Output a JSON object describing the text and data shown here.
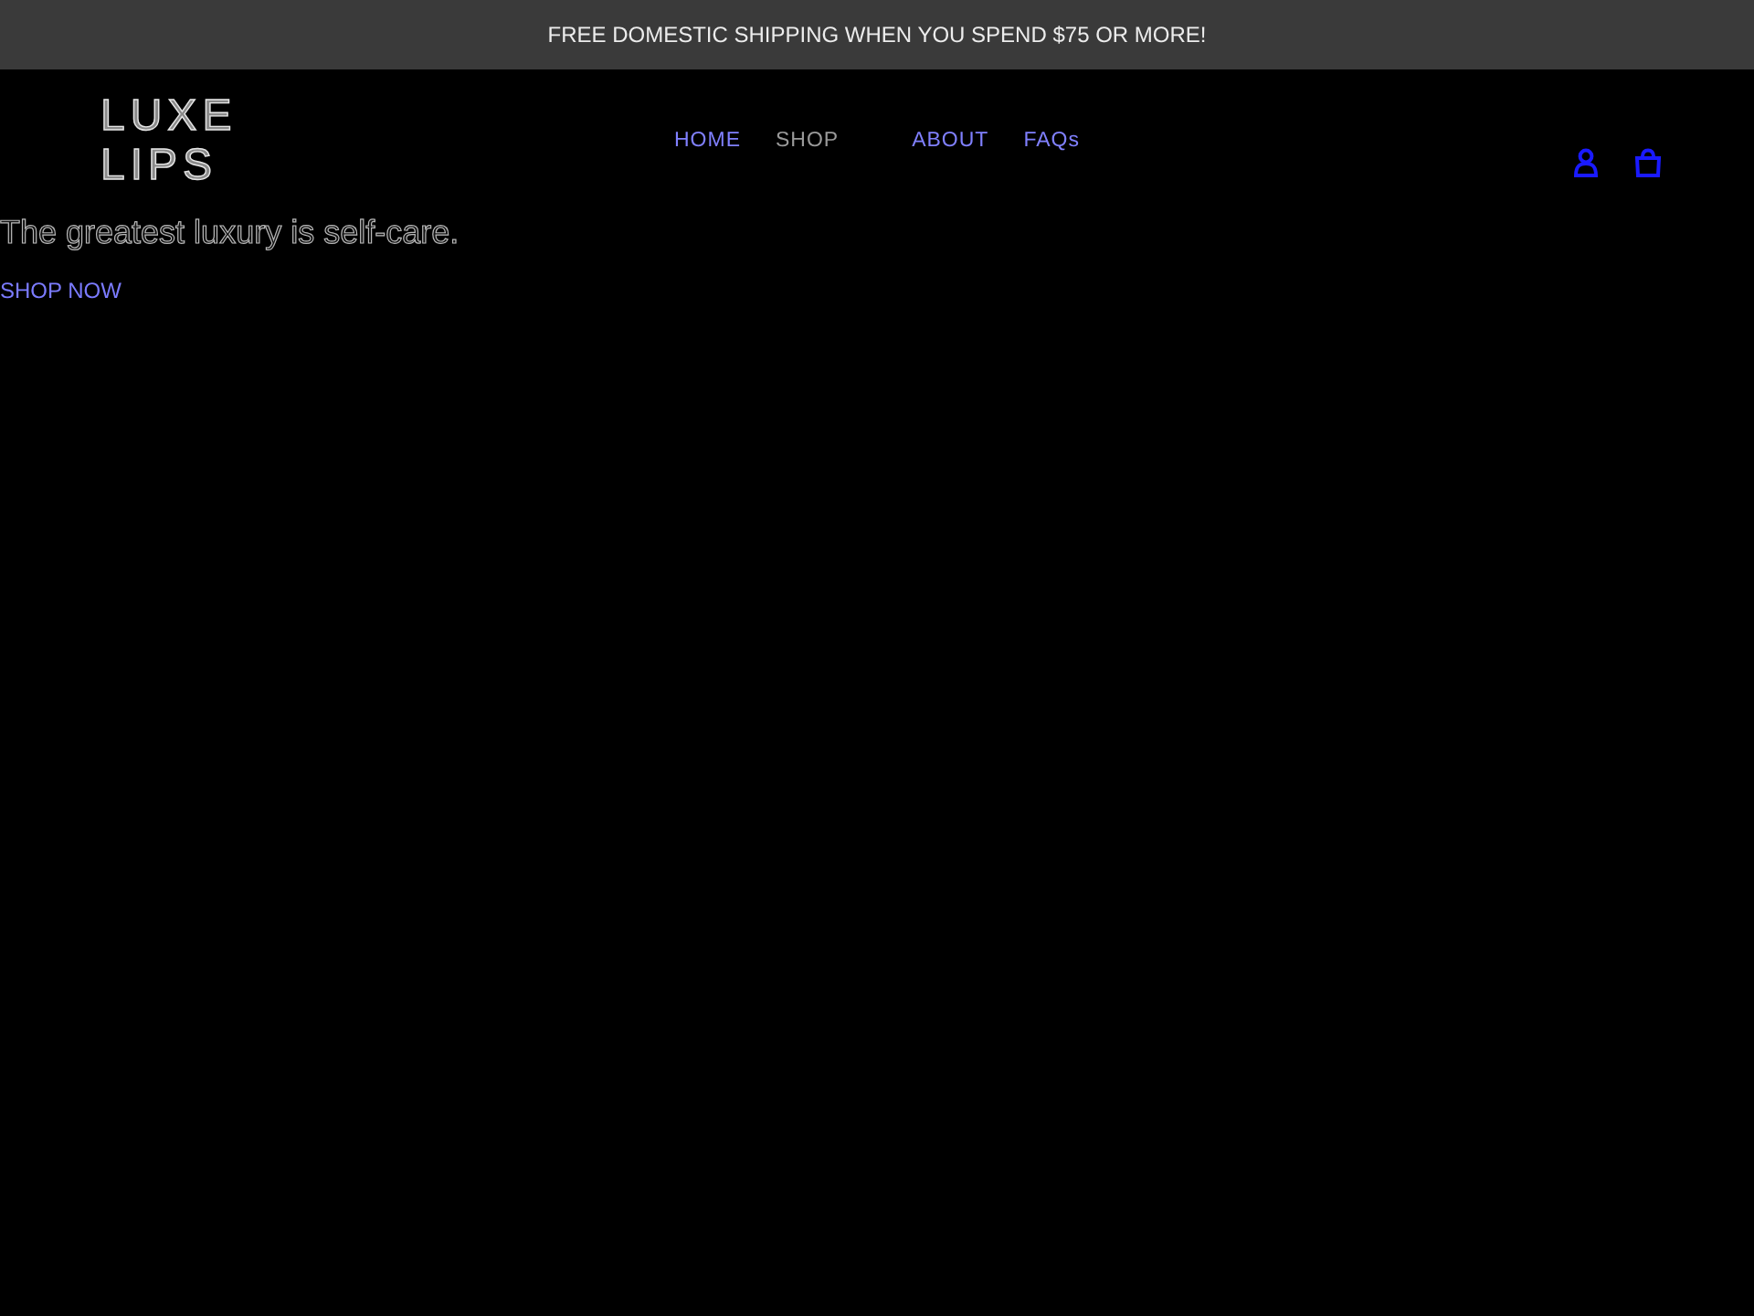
{
  "announcement": {
    "text": "FREE DOMESTIC SHIPPING WHEN YOU SPEND $75 OR MORE!"
  },
  "header": {
    "logo": {
      "lines": [
        "LUXE",
        "LIPS"
      ]
    },
    "nav": [
      {
        "label": "HOME",
        "kind": "link"
      },
      {
        "label": "SHOP",
        "kind": "dropdown"
      },
      {
        "label": "ABOUT",
        "kind": "link"
      },
      {
        "label": "FAQs",
        "kind": "link"
      }
    ],
    "icons": [
      {
        "kind": "account"
      },
      {
        "kind": "cart"
      }
    ]
  },
  "hero": {
    "heading": "The greatest luxury is self-care.",
    "button": "SHOP NOW"
  }
}
